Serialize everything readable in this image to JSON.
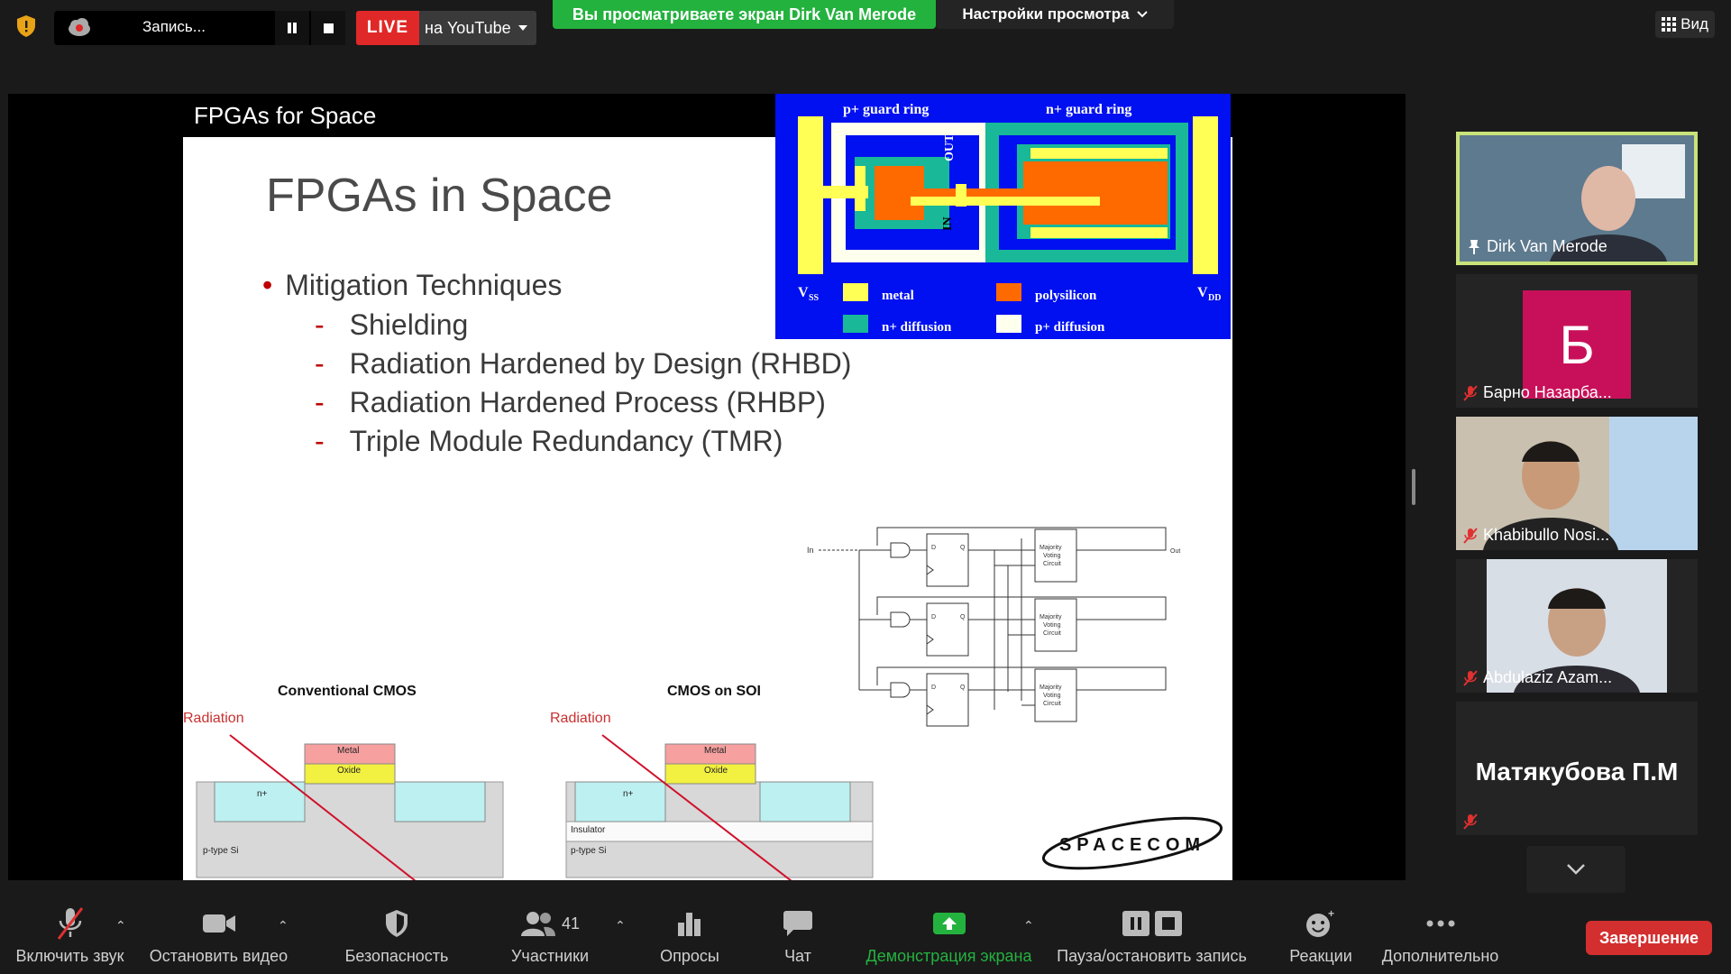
{
  "topbar": {
    "recording_label": "Запись...",
    "live_label": "LIVE",
    "youtube_label": "на YouTube",
    "viewing_banner": "Вы просматриваете экран Dirk Van Merode",
    "view_settings": "Настройки просмотра",
    "view_button": "Вид"
  },
  "slide": {
    "header": "FPGAs for Space",
    "title": "FPGAs in Space",
    "bullet": "Mitigation Techniques",
    "sub_bullets": [
      "Shielding",
      "Radiation Hardened by Design (RHBD)",
      "Radiation Hardened Process (RHBP)",
      "Triple Module Redundancy (TMR)"
    ],
    "guard_ring": {
      "p_guard": "p+ guard ring",
      "n_guard": "n+ guard ring",
      "out": "OUT",
      "in": "IN",
      "vss": "V",
      "vss_sub": "SS",
      "vdd": "V",
      "vdd_sub": "DD",
      "legend": [
        "metal",
        "polysilicon",
        "n+ diffusion",
        "p+ diffusion"
      ],
      "colors": {
        "bg": "#0010f0",
        "metal": "#ffff55",
        "poly": "#ff6a00",
        "ndiff": "#18b898",
        "pdiff": "#ffffee"
      }
    },
    "tmr": {
      "in_label": "In",
      "out_label": "Out",
      "d": "D",
      "q": "Q",
      "voter": [
        "Majority",
        "Voting",
        "Circuit"
      ]
    },
    "cmos": {
      "conventional_title": "Conventional CMOS",
      "soi_title": "CMOS on SOI",
      "radiation": "Radiation",
      "metal": "Metal",
      "oxide": "Oxide",
      "nplus": "n+",
      "ptype": "p-type Si",
      "insulator": "Insulator"
    },
    "logo": "SPACECOM"
  },
  "participants": [
    {
      "name": "Dirk Van Merode",
      "icon": "pin-icon",
      "active": true
    },
    {
      "name": "Барно Назарба...",
      "icon": "mic-off-icon",
      "initial": "Б",
      "initial_color": "#c8105a"
    },
    {
      "name": "Khabibullo Nosi...",
      "icon": "mic-off-icon"
    },
    {
      "name": "Abdulaziz Azam...",
      "icon": "mic-off-icon"
    },
    {
      "name": "Матякубова П.М",
      "icon": "mic-off-icon",
      "name_only": true
    }
  ],
  "toolbar": {
    "unmute": "Включить звук",
    "stop_video": "Остановить видео",
    "security": "Безопасность",
    "participants": "Участники",
    "participants_count": "41",
    "polls": "Опросы",
    "chat": "Чат",
    "share_screen": "Демонстрация экрана",
    "pause_record": "Пауза/остановить запись",
    "reactions": "Реакции",
    "more": "Дополнительно",
    "end": "Завершение"
  },
  "colors": {
    "accent_green": "#24b23f",
    "live_red": "#e02828",
    "end_red": "#d32f2f",
    "active_border": "#c9e37a"
  }
}
